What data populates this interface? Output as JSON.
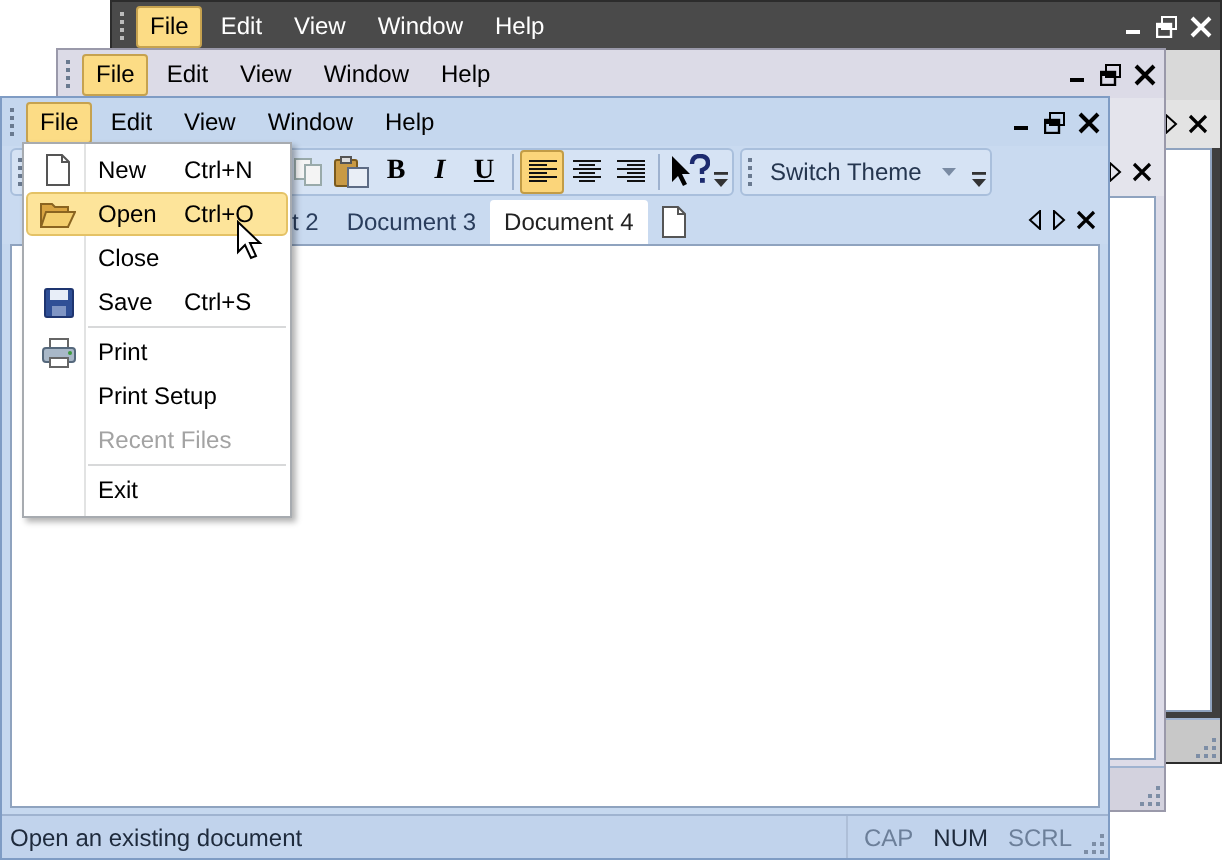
{
  "windows": [
    {
      "menu": [
        {
          "label": "File",
          "selected": true
        },
        {
          "label": "Edit",
          "selected": false
        },
        {
          "label": "View",
          "selected": false
        },
        {
          "label": "Window",
          "selected": false
        },
        {
          "label": "Help",
          "selected": false
        }
      ]
    },
    {
      "menu": [
        {
          "label": "File",
          "selected": true
        },
        {
          "label": "Edit",
          "selected": false
        },
        {
          "label": "View",
          "selected": false
        },
        {
          "label": "Window",
          "selected": false
        },
        {
          "label": "Help",
          "selected": false
        }
      ]
    },
    {
      "menu": [
        {
          "label": "File",
          "selected": true
        },
        {
          "label": "Edit",
          "selected": false
        },
        {
          "label": "View",
          "selected": false
        },
        {
          "label": "Window",
          "selected": false
        },
        {
          "label": "Help",
          "selected": false
        }
      ],
      "toolbar": [
        {
          "kind": "copy"
        },
        {
          "kind": "paste"
        },
        {
          "kind": "bold",
          "label": "B"
        },
        {
          "kind": "italic",
          "label": "I"
        },
        {
          "kind": "underline",
          "label": "U"
        },
        {
          "kind": "separator"
        },
        {
          "kind": "align",
          "selected": true
        },
        {
          "kind": "align",
          "selected": false
        },
        {
          "kind": "align",
          "selected": false
        },
        {
          "kind": "separator"
        },
        {
          "kind": "help"
        }
      ],
      "theme_toolbar": {
        "label": "Switch Theme"
      },
      "tabs": [
        {
          "label": "t 2",
          "selected": false
        },
        {
          "label": "Document 3",
          "selected": false
        },
        {
          "label": "Document 4",
          "selected": true
        }
      ],
      "status_bar": {
        "message": "Open an existing document",
        "indicators": [
          {
            "label": "CAP",
            "on": false
          },
          {
            "label": "NUM",
            "on": true
          },
          {
            "label": "SCRL",
            "on": false
          }
        ]
      }
    }
  ],
  "file_menu": [
    {
      "kind": "item",
      "label": "New",
      "shortcut": "Ctrl+N",
      "selected": false,
      "disabled": false
    },
    {
      "kind": "item",
      "label": "Open",
      "shortcut": "Ctrl+O",
      "selected": true,
      "disabled": false
    },
    {
      "kind": "item",
      "label": "Close",
      "selected": false,
      "disabled": false
    },
    {
      "kind": "item",
      "label": "Save",
      "shortcut": "Ctrl+S",
      "selected": false,
      "disabled": false
    },
    {
      "kind": "separator"
    },
    {
      "kind": "item",
      "label": "Print",
      "selected": false,
      "disabled": false
    },
    {
      "kind": "item",
      "label": "Print Setup",
      "selected": false,
      "disabled": false
    },
    {
      "kind": "item",
      "label": "Recent Files",
      "selected": false,
      "disabled": true
    },
    {
      "kind": "separator"
    },
    {
      "kind": "item",
      "label": "Exit",
      "selected": false,
      "disabled": false
    }
  ]
}
